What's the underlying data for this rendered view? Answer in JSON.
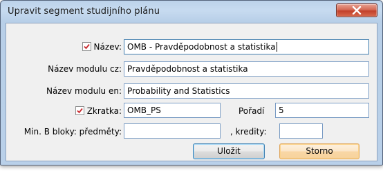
{
  "window": {
    "title": "Upravit segment studijního plánu"
  },
  "form": {
    "nazev": {
      "label": "Název:",
      "checked": true,
      "value": "OMB - Pravděpodobnost a statistika"
    },
    "nazev_cz": {
      "label": "Název modulu cz:",
      "value": "Pravděpodobnost a statistika"
    },
    "nazev_en": {
      "label": "Název modulu en:",
      "value": "Probability and Statistics"
    },
    "zkratka": {
      "label": "Zkratka:",
      "checked": true,
      "value": "OMB_PS"
    },
    "poradi": {
      "label": "Pořadí",
      "value": "5"
    },
    "min_predmety": {
      "label": "Min. B bloky: předměty:",
      "value": ""
    },
    "min_kredity": {
      "label": ", kredity:",
      "value": ""
    }
  },
  "buttons": {
    "save": "Uložit",
    "cancel": "Storno"
  },
  "colors": {
    "check": "#c8262b",
    "accent": "#3c7fb1",
    "close": "#c2402a"
  },
  "icons": {
    "close": "close-icon",
    "check": "checkmark-icon"
  }
}
